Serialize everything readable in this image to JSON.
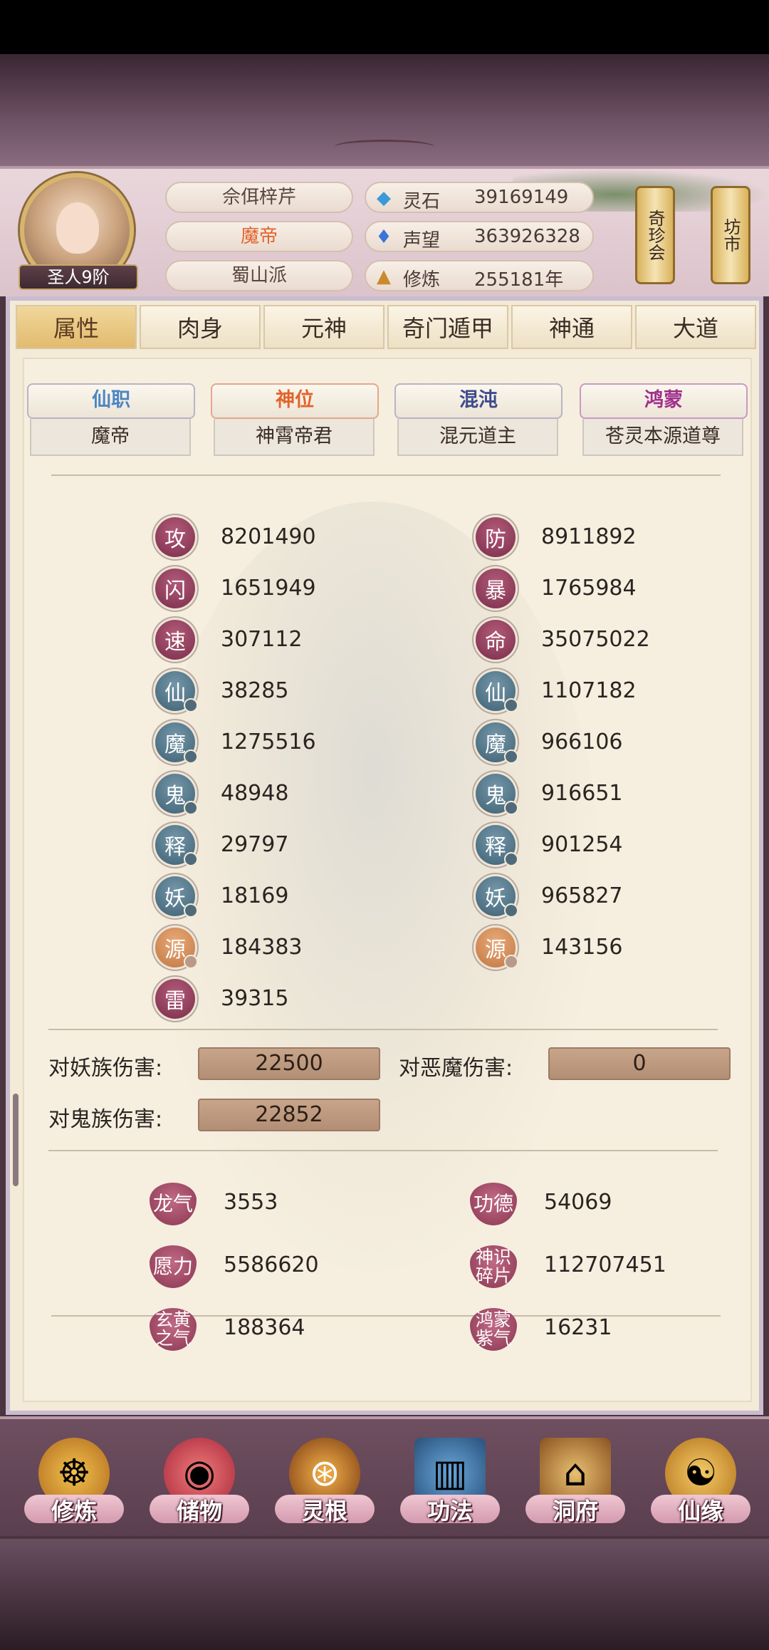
{
  "header": {
    "name": "佘佴梓芹",
    "title": "魔帝",
    "sect": "蜀山派",
    "rank": "圣人9阶",
    "resources": [
      {
        "icon": "spirit-stone-icon",
        "label": "灵石",
        "value": "39169149"
      },
      {
        "icon": "prestige-icon",
        "label": "声望",
        "value": "363926328"
      },
      {
        "icon": "cultivation-icon",
        "label": "修炼",
        "value": "255181年"
      }
    ],
    "buttons": [
      {
        "label": "奇珍会"
      },
      {
        "label": "坊市"
      }
    ]
  },
  "tabs": [
    "属性",
    "肉身",
    "元神",
    "奇门遁甲",
    "神通",
    "大道"
  ],
  "active_tab": "属性",
  "categories": [
    {
      "label": "仙职",
      "value": "魔帝",
      "color": "#4c86c4"
    },
    {
      "label": "神位",
      "value": "神霄帝君",
      "color": "#e2632c"
    },
    {
      "label": "混沌",
      "value": "混元道主",
      "color": "#3d4a8c"
    },
    {
      "label": "鸿蒙",
      "value": "苍灵本源道尊",
      "color": "#a0308c"
    }
  ],
  "stats_left": [
    {
      "char": "攻",
      "value": "8201490",
      "tone": "red"
    },
    {
      "char": "闪",
      "value": "1651949",
      "tone": "red"
    },
    {
      "char": "速",
      "value": "307112",
      "tone": "red"
    },
    {
      "char": "仙",
      "value": "38285",
      "tone": "blue"
    },
    {
      "char": "魔",
      "value": "1275516",
      "tone": "blue"
    },
    {
      "char": "鬼",
      "value": "48948",
      "tone": "blue"
    },
    {
      "char": "释",
      "value": "29797",
      "tone": "blue"
    },
    {
      "char": "妖",
      "value": "18169",
      "tone": "blue"
    },
    {
      "char": "源",
      "value": "184383",
      "tone": "orange"
    },
    {
      "char": "雷",
      "value": "39315",
      "tone": "red"
    }
  ],
  "stats_right": [
    {
      "char": "防",
      "value": "8911892",
      "tone": "red"
    },
    {
      "char": "暴",
      "value": "1765984",
      "tone": "red"
    },
    {
      "char": "命",
      "value": "35075022",
      "tone": "red"
    },
    {
      "char": "仙",
      "value": "1107182",
      "tone": "blue"
    },
    {
      "char": "魔",
      "value": "966106",
      "tone": "blue"
    },
    {
      "char": "鬼",
      "value": "916651",
      "tone": "blue"
    },
    {
      "char": "释",
      "value": "901254",
      "tone": "blue"
    },
    {
      "char": "妖",
      "value": "965827",
      "tone": "blue"
    },
    {
      "char": "源",
      "value": "143156",
      "tone": "orange"
    }
  ],
  "damage": {
    "yao_label": "对妖族伤害:",
    "yao_value": "22500",
    "demon_label": "对恶魔伤害:",
    "demon_value": "0",
    "ghost_label": "对鬼族伤害:",
    "ghost_value": "22852"
  },
  "misc": {
    "dragon_label": "龙气",
    "dragon_value": "3553",
    "merit_label": "功德",
    "merit_value": "54069",
    "wish_label": "愿力",
    "wish_value": "5586620",
    "shard_label1": "神识",
    "shard_label2": "碎片",
    "shard_value": "112707451",
    "xuan_label1": "玄黄",
    "xuan_label2": "之气",
    "xuan_value": "188364",
    "hong_label1": "鸿蒙",
    "hong_label2": "紫气",
    "hong_value": "16231"
  },
  "nav": [
    "修炼",
    "储物",
    "灵根",
    "功法",
    "洞府",
    "仙缘"
  ]
}
